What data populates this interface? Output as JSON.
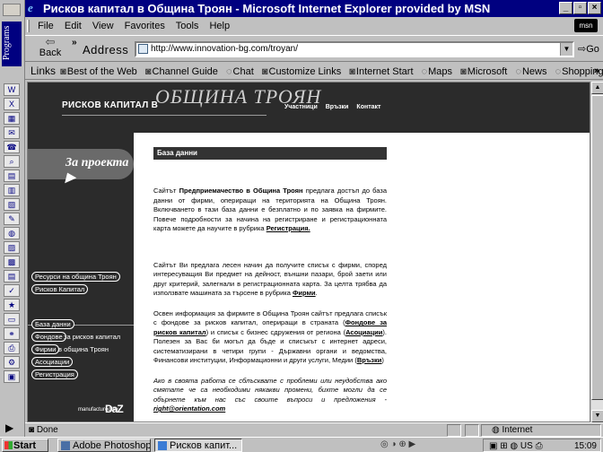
{
  "officebar": {
    "title": "Programs"
  },
  "window": {
    "title": "Рисков капитал в Община Троян - Microsoft Internet Explorer provided by MSN",
    "min": "_",
    "max": "▫",
    "close": "×"
  },
  "menu": [
    "File",
    "Edit",
    "View",
    "Favorites",
    "Tools",
    "Help"
  ],
  "toolbar": {
    "back_label": "Back",
    "address_label": "Address",
    "address_value": "http://www.innovation-bg.com/troyan/",
    "go_label": "Go"
  },
  "links": {
    "label": "Links",
    "items": [
      "Best of the Web",
      "Channel Guide",
      "Chat",
      "Customize Links",
      "Internet Start",
      "Maps",
      "Microsoft",
      "News",
      "Shopping"
    ]
  },
  "site": {
    "title_small": "РИСКОВ КАПИТАЛ В",
    "title_big": "ОБЩИНА ТРОЯН",
    "nav": [
      "Участници",
      "Връзки",
      "Контакт"
    ],
    "section_tab": "За проекта",
    "sidebar_top": [
      "Ресурси на община Троян",
      "Рисков Капитал"
    ],
    "sidebar_bottom": [
      {
        "pill": "База данни",
        "rest": ""
      },
      {
        "pill": "Фондове",
        "rest": "за рисков капитал"
      },
      {
        "pill": "Фирми",
        "rest": "в община Троян"
      },
      {
        "pill": "Асоциации",
        "rest": ""
      },
      {
        "pill": "Регистрация",
        "rest": ""
      }
    ],
    "manufactured_by": "manufactured by",
    "manufacturer_logo": "DaZ"
  },
  "content": {
    "header": "База данни",
    "p1_a": "Сайтът ",
    "p1_b": "Предприемачество в Община Троян",
    "p1_c": " предлага достъп до база данни от фирми, опериращи на територията на Община Троян. Включването в тази база данни е безплатно и по заявка на фирмите. Повече подробности за начина на регистриране и регистрационната карта можете да научите в рубрика ",
    "p1_link": "Регистрация.",
    "p2_a": "Сайтът Ви предлага лесен начин да получите списък с фирми, според интересуващия Ви предмет на дейност, външни пазари, брой заети или друг критерий, залегнали в регистрационната карта. За целта трябва да използвате машината за търсене в рубрика ",
    "p2_link": "Фирми",
    "p2_end": ".",
    "p3_a": "Освен информация за фирмите в Община Троян сайтът предлага списък с фондове за рисков капитал, опериращи в страната (",
    "p3_link1": "Фондове за рисков капитал",
    "p3_b": ") и списък с бизнес сдружения от региона (",
    "p3_link2": "Асоциации",
    "p3_c": "). Полезен за Вас би могъл да бъде и списъкът с интернет адреси, систематизирани в четири групи - Държавни органи и ведомства, Финансови институции, Информационни и други услуги, Медии (",
    "p3_link3": "Връзки",
    "p3_d": ")",
    "p4": "Ако в своята работа се сблъсквате с проблеми или неудобства ако смятате че са необходими някакви промени, бихте могли да се обърнете към нас със своите въпроси и предложения - ",
    "p4_email": "right@orientation.com"
  },
  "status": {
    "text": "Done",
    "zone": "Internet"
  },
  "taskbar": {
    "start": "Start",
    "tasks": [
      "Adobe Photoshop",
      "Рисков капит..."
    ],
    "tray_lang": "US",
    "clock": "15:09"
  }
}
